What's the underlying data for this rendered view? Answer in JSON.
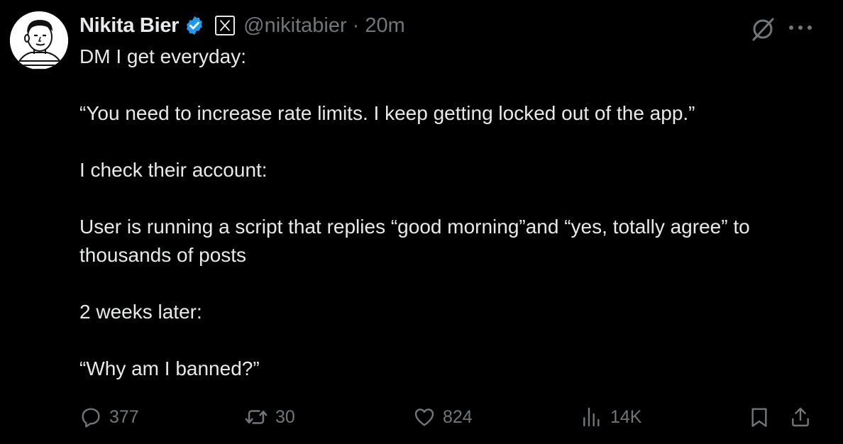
{
  "tweet": {
    "author": {
      "display_name": "Nikita Bier",
      "handle": "@nikitabier",
      "verified": true,
      "affiliation_badge": "x-logo-icon"
    },
    "separator": "·",
    "timestamp": "20m",
    "body": {
      "p1": "DM I get everyday:",
      "p2": "“You need to increase rate limits. I keep getting locked out of the app.”",
      "p3": "I check their account:",
      "p4": "User is running a script that replies “good morning”and “yes, totally agree” to thousands of posts",
      "p5": "2 weeks later:",
      "p6": "“Why am I banned?”"
    },
    "metrics": {
      "replies": "377",
      "reposts": "30",
      "likes": "824",
      "views": "14K"
    }
  },
  "colors": {
    "background": "#000000",
    "text_primary": "#e7e9ea",
    "text_secondary": "#71767b",
    "verified_blue": "#1d9bf0"
  },
  "icons": {
    "grok": "grok-icon",
    "more": "more-icon",
    "reply": "reply-icon",
    "repost": "repost-icon",
    "like": "heart-icon",
    "views": "views-icon",
    "bookmark": "bookmark-icon",
    "share": "share-icon"
  }
}
